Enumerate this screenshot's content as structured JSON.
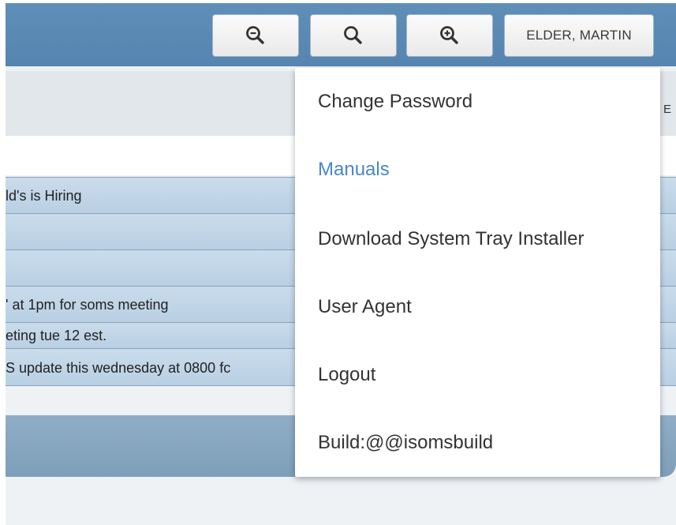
{
  "header": {
    "zoom_out_icon": "zoom-out-icon",
    "zoom_reset_icon": "search-icon",
    "zoom_in_icon": "zoom-in-icon",
    "user_name": "ELDER, MARTIN"
  },
  "panel": {
    "edge_label": "E"
  },
  "messages": [
    "ld's is Hiring",
    "",
    "",
    "' at 1pm for soms meeting",
    "eting tue 12 est.",
    "S update this wednesday at 0800 fc"
  ],
  "user_menu": {
    "items": [
      {
        "label": "Change Password"
      },
      {
        "label": "Manuals"
      },
      {
        "label": "Download System Tray Installer"
      },
      {
        "label": "User Agent"
      },
      {
        "label": "Logout"
      },
      {
        "label": "Build:@@isomsbuild"
      }
    ]
  },
  "colors": {
    "header_bar": "#5a8ab4",
    "active_menu_item": "#4a86c8",
    "row_bg": "#c2d6e8"
  }
}
